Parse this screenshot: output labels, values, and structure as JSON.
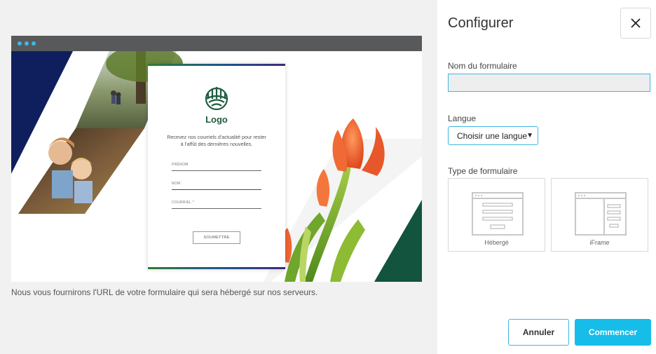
{
  "preview": {
    "caption": "Nous vous fournirons l'URL de votre formulaire qui sera hébergé sur nos serveurs.",
    "form_logo_text": "Logo",
    "form_intro": "Recevez nos courriels d'actualité pour rester à l'affût des dernières nouvelles.",
    "fields": [
      "PRÉNOM",
      "NOM",
      "COURRIEL *"
    ],
    "submit_label": "SOUMETTRE"
  },
  "panel": {
    "title": "Configurer",
    "close_icon": "close-icon",
    "form_name_label": "Nom du formulaire",
    "form_name_value": "",
    "language_label": "Langue",
    "language_selected": "Choisir une langue",
    "form_type_label": "Type de formulaire",
    "form_types": [
      {
        "label": "Hébergé",
        "icon": "hosted-form-icon"
      },
      {
        "label": "iFrame",
        "icon": "iframe-form-icon"
      }
    ],
    "cancel_label": "Annuler",
    "start_label": "Commencer"
  },
  "colors": {
    "accent": "#16bde8",
    "navy": "#0f1f5e",
    "forest": "#12543d",
    "logo_green": "#1f5c3f"
  }
}
